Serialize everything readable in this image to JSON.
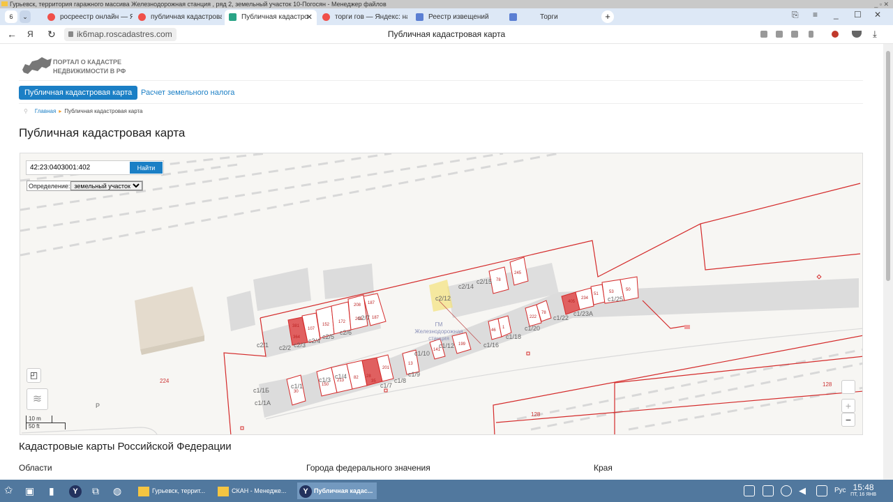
{
  "window": {
    "title": "Гурьевск, территория гаражного массива Железнодорожная станция , ряд 2, земельный участок 10-Погосян - Менеджер файлов"
  },
  "browser": {
    "tab_count": "6",
    "tabs": [
      {
        "label": "росреестр онлайн — Янд"
      },
      {
        "label": "публичная кадастрован"
      },
      {
        "label": "Публичная кадастро"
      },
      {
        "label": "торги гов — Яндекс: нашл"
      },
      {
        "label": "Реестр извещений"
      },
      {
        "label": "Торги"
      }
    ],
    "url": "ik6map.roscadastres.com",
    "page_title": "Публичная кадастровая карта"
  },
  "site": {
    "logo_line1": "ПОРТАЛ О КАДАСТРЕ",
    "logo_line2": "НЕДВИЖИМОСТИ В РФ",
    "menu": [
      "Публичная кадастровая карта",
      "Расчет земельного налога"
    ],
    "breadcrumb": {
      "home": "Главная",
      "current": "Публичная кадастровая карта"
    },
    "heading": "Публичная кадастровая карта"
  },
  "map": {
    "search_value": "42:23:0403001:402",
    "search_button": "Найти",
    "definition_label": "Определение:",
    "definition_value": "земельный участок",
    "poi": "ГМ Железнодорожная станция",
    "poi_line1": "ГМ",
    "poi_line2": "Железнодорожная",
    "poi_line3": "станция",
    "scale_m": "10 m",
    "scale_ft": "50 ft",
    "zoom_in": "+",
    "zoom_out": "−",
    "labels": [
      "c2/1",
      "c2/2",
      "c2/3",
      "c2/4",
      "c2/5",
      "c2/6",
      "c2/7",
      "c2/12",
      "c2/14",
      "c2/15",
      "c1/1А",
      "c1/1Б",
      "c1/1",
      "c1/3",
      "c1/4",
      "c1/7",
      "c1/8",
      "c1/9",
      "c1/10",
      "c1/12",
      "c1/16",
      "c1/18",
      "c1/20",
      "c1/22",
      "c1/23А",
      "c1/25",
      "224",
      "P",
      "128",
      "128"
    ],
    "parcels": [
      "381",
      "364",
      "107",
      "152",
      "172",
      "208",
      "208",
      "187",
      "187",
      "78",
      "245",
      "30",
      "150",
      "213",
      "82",
      "28",
      "35",
      "201",
      "13",
      "141",
      "199",
      "46",
      "1",
      "222",
      "78",
      "405",
      "234",
      "51",
      "53",
      "50"
    ]
  },
  "footer": {
    "heading": "Кадастровые карты Российской Федерации",
    "cols": [
      "Области",
      "Города федерального значения",
      "Края"
    ]
  },
  "taskbar": {
    "items": [
      "Гурьевск, террит...",
      "СКАН - Менедже...",
      "Публичная кадас..."
    ],
    "lang": "Рус",
    "time": "15:48",
    "date": "ПТ, 16 ЯНВ"
  }
}
